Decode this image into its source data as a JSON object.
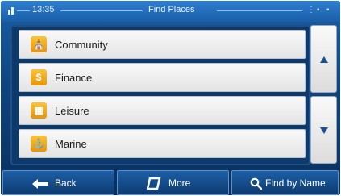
{
  "status_bar": {
    "time": "13:35",
    "title": "Find Places",
    "icons": [
      "gps-icon",
      "signal-icon",
      "battery-icon"
    ]
  },
  "list": {
    "items": [
      {
        "label": "Community",
        "icon": "community-icon",
        "glyph": "⛪"
      },
      {
        "label": "Finance",
        "icon": "finance-icon",
        "glyph": "$"
      },
      {
        "label": "Leisure",
        "icon": "leisure-icon",
        "glyph": "▦"
      },
      {
        "label": "Marine",
        "icon": "marine-icon",
        "glyph": "⚓"
      }
    ]
  },
  "scroll": {
    "up": "scroll-up-icon",
    "down": "scroll-down-icon"
  },
  "bottom_bar": {
    "back_label": "Back",
    "more_label": "More",
    "find_label": "Find by Name"
  },
  "colors": {
    "background": "#0e447e",
    "status_bar": "#2f7fd0",
    "item_bg": "#f0f0f0",
    "icon_orange": "#f2a81d"
  }
}
